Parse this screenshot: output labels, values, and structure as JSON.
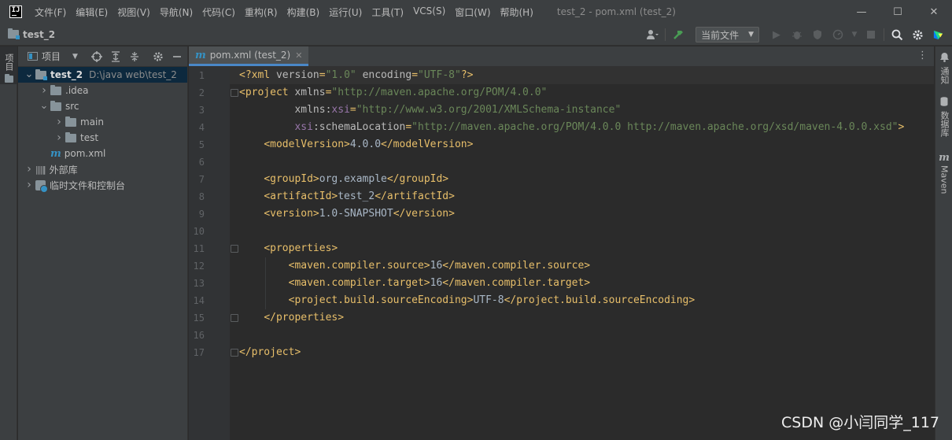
{
  "titlebar": {
    "logo": "IJ",
    "menu": [
      "文件(F)",
      "编辑(E)",
      "视图(V)",
      "导航(N)",
      "代码(C)",
      "重构(R)",
      "构建(B)",
      "运行(U)",
      "工具(T)",
      "VCS(S)",
      "窗口(W)",
      "帮助(H)"
    ],
    "window_title": "test_2 - pom.xml (test_2)",
    "minimize": "—",
    "maximize": "☐",
    "close": "✕"
  },
  "navbar": {
    "project_crumb": "test_2",
    "run_config": "当前文件",
    "icons": [
      "user-vcs-icon",
      "build-hammer-icon",
      "run-icon",
      "debug-icon",
      "coverage-icon",
      "profile-icon",
      "stop-icon",
      "search-icon",
      "settings-icon",
      "jetbrains-toolbox-icon"
    ]
  },
  "left_stripe": {
    "project_tab": "项目"
  },
  "project_panel": {
    "title": "项目",
    "tree": [
      {
        "name": "test_2",
        "path": "D:\\java web\\test_2",
        "level": 0,
        "expanded": true,
        "selected": true,
        "type": "module"
      },
      {
        "name": ".idea",
        "level": 1,
        "expanded": false,
        "type": "folder"
      },
      {
        "name": "src",
        "level": 1,
        "expanded": true,
        "type": "folder"
      },
      {
        "name": "main",
        "level": 2,
        "expanded": false,
        "type": "folder"
      },
      {
        "name": "test",
        "level": 2,
        "expanded": false,
        "type": "folder"
      },
      {
        "name": "pom.xml",
        "level": 1,
        "type": "maven"
      },
      {
        "name": "外部库",
        "level": 0,
        "expanded": false,
        "type": "library"
      },
      {
        "name": "临时文件和控制台",
        "level": 0,
        "expanded": false,
        "type": "scratch"
      }
    ]
  },
  "editor": {
    "tab_label": "pom.xml (test_2)",
    "line_numbers": [
      "1",
      "2",
      "3",
      "4",
      "5",
      "6",
      "7",
      "8",
      "9",
      "10",
      "11",
      "12",
      "13",
      "14",
      "15",
      "16",
      "17"
    ],
    "lines": [
      [
        [
          "t-tag",
          "<?xml "
        ],
        [
          "t-attr",
          "version"
        ],
        [
          "t-tag",
          "="
        ],
        [
          "t-str",
          "\"1.0\""
        ],
        [
          "t-tag",
          " "
        ],
        [
          "t-attr",
          "encoding"
        ],
        [
          "t-tag",
          "="
        ],
        [
          "t-str",
          "\"UTF-8\""
        ],
        [
          "t-tag",
          "?>"
        ]
      ],
      [
        [
          "t-tag",
          "<project "
        ],
        [
          "t-attr",
          "xmlns"
        ],
        [
          "t-tag",
          "="
        ],
        [
          "t-str",
          "\"http://maven.apache.org/POM/4.0.0\""
        ]
      ],
      [
        [
          "t-text",
          "         "
        ],
        [
          "t-attr",
          "xmlns:"
        ],
        [
          "t-ns",
          "xsi"
        ],
        [
          "t-tag",
          "="
        ],
        [
          "t-str",
          "\"http://www.w3.org/2001/XMLSchema-instance\""
        ]
      ],
      [
        [
          "t-text",
          "         "
        ],
        [
          "t-ns",
          "xsi"
        ],
        [
          "t-attr",
          ":schemaLocation"
        ],
        [
          "t-tag",
          "="
        ],
        [
          "t-str",
          "\"http://maven.apache.org/POM/4.0.0 http://maven.apache.org/xsd/maven-4.0.0.xsd\""
        ],
        [
          "t-tag",
          ">"
        ]
      ],
      [
        [
          "t-text",
          "    "
        ],
        [
          "t-tag",
          "<modelVersion>"
        ],
        [
          "t-text",
          "4.0.0"
        ],
        [
          "t-tag",
          "</modelVersion>"
        ]
      ],
      [],
      [
        [
          "t-text",
          "    "
        ],
        [
          "t-tag",
          "<groupId>"
        ],
        [
          "t-text",
          "org.example"
        ],
        [
          "t-tag",
          "</groupId>"
        ]
      ],
      [
        [
          "t-text",
          "    "
        ],
        [
          "t-tag",
          "<artifactId>"
        ],
        [
          "t-text",
          "test_2"
        ],
        [
          "t-tag",
          "</artifactId>"
        ]
      ],
      [
        [
          "t-text",
          "    "
        ],
        [
          "t-tag",
          "<version>"
        ],
        [
          "t-text",
          "1.0-SNAPSHOT"
        ],
        [
          "t-tag",
          "</version>"
        ]
      ],
      [],
      [
        [
          "t-text",
          "    "
        ],
        [
          "t-tag",
          "<properties>"
        ]
      ],
      [
        [
          "t-text",
          "        "
        ],
        [
          "t-tag",
          "<maven.compiler.source>"
        ],
        [
          "t-text",
          "16"
        ],
        [
          "t-tag",
          "</maven.compiler.source>"
        ]
      ],
      [
        [
          "t-text",
          "        "
        ],
        [
          "t-tag",
          "<maven.compiler.target>"
        ],
        [
          "t-text",
          "16"
        ],
        [
          "t-tag",
          "</maven.compiler.target>"
        ]
      ],
      [
        [
          "t-text",
          "        "
        ],
        [
          "t-tag",
          "<project.build.sourceEncoding>"
        ],
        [
          "t-text",
          "UTF-8"
        ],
        [
          "t-tag",
          "</project.build.sourceEncoding>"
        ]
      ],
      [
        [
          "t-text",
          "    "
        ],
        [
          "t-tag",
          "</properties>"
        ]
      ],
      [],
      [
        [
          "t-tag",
          "</project>"
        ]
      ]
    ],
    "fold_lines": [
      2,
      11,
      15,
      17
    ]
  },
  "right_stripe": {
    "tabs": [
      {
        "icon": "notification-bell-icon",
        "label": "通知"
      },
      {
        "icon": "database-icon",
        "label": "数据库"
      },
      {
        "icon": "maven-icon",
        "label": "Maven"
      }
    ]
  },
  "watermark": "CSDN @小闫同学_117"
}
